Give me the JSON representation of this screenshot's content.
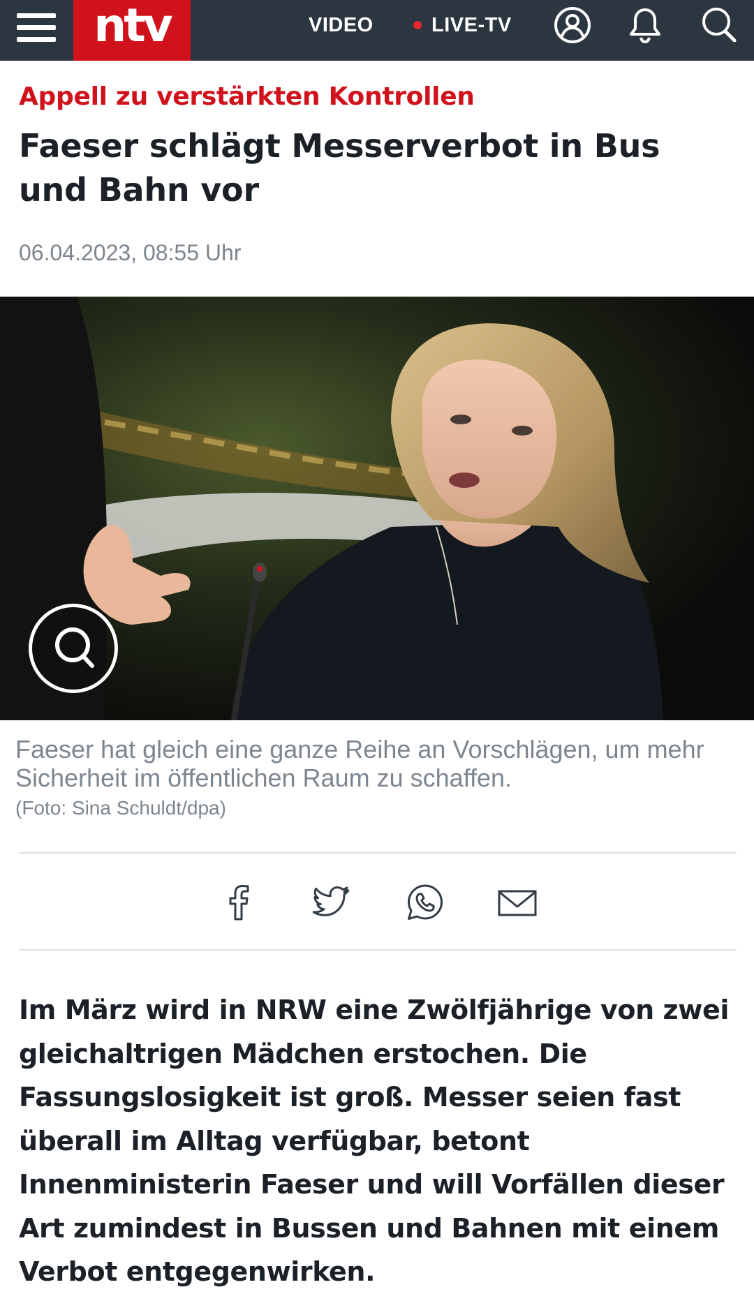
{
  "header": {
    "logo": "ntv",
    "nav": {
      "video": "VIDEO",
      "live_tv": "LIVE-TV"
    },
    "icons": [
      "menu-icon",
      "user-icon",
      "bell-icon",
      "search-icon"
    ],
    "colors": {
      "bar": "#2c3640",
      "brand": "#d0121c",
      "live_dot": "#e3262f"
    }
  },
  "article": {
    "kicker": "Appell zu verstärkten Kontrollen",
    "headline": "Faeser schlägt Messerverbot in Bus und Bahn vor",
    "date": "06.04.2023, 08:55 Uhr",
    "image": {
      "zoom_icon": "zoom-icon",
      "caption": "Faeser hat gleich eine ganze Reihe an Vorschlägen, um mehr Sicherheit im öffentlichen Raum zu schaffen.",
      "credit": "(Foto: Sina Schuldt/dpa)"
    },
    "share": {
      "icons": [
        "facebook-icon",
        "twitter-icon",
        "whatsapp-icon",
        "mail-icon"
      ]
    },
    "teaser": "Im März wird in NRW eine Zwölfjährige von zwei gleichaltrigen Mädchen erstochen. Die Fassungslosigkeit ist groß. Messer seien fast überall im Alltag verfügbar, betont Innenministerin Faeser und will Vorfällen dieser Art zumindest in Bussen und Bahnen mit einem Verbot entgegenwirken."
  }
}
